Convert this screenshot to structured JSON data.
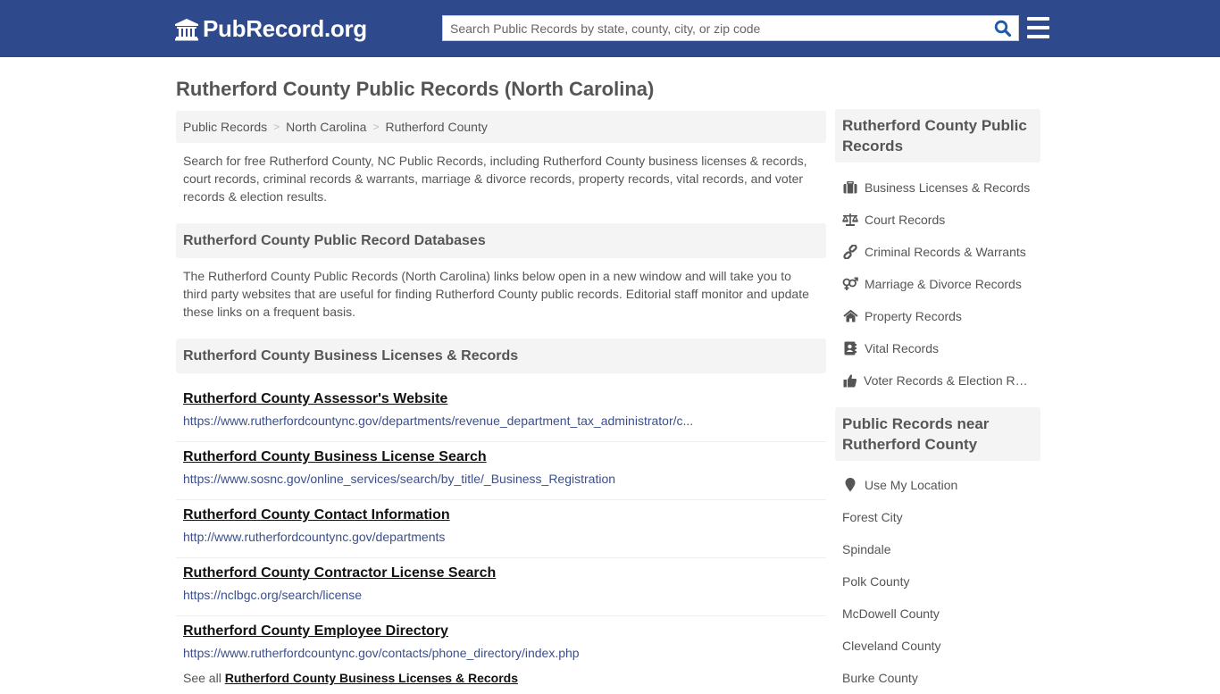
{
  "header": {
    "logo_text": "PubRecord.org",
    "search_placeholder": "Search Public Records by state, county, city, or zip code",
    "search_value": "",
    "brand_color": "#2e4a8c"
  },
  "page_title": "Rutherford County Public Records (North Carolina)",
  "breadcrumb": [
    {
      "label": "Public Records"
    },
    {
      "label": "North Carolina"
    },
    {
      "label": "Rutherford County"
    }
  ],
  "intro": "Search for free Rutherford County, NC Public Records, including Rutherford County business licenses & records, court records, criminal records & warrants, marriage & divorce records, property records, vital records, and voter records & election results.",
  "databases": {
    "heading": "Rutherford County Public Record Databases",
    "text": "The Rutherford County Public Records (North Carolina) links below open in a new window and will take you to third party websites that are useful for finding Rutherford County public records. Editorial staff monitor and update these links on a frequent basis."
  },
  "business": {
    "heading": "Rutherford County Business Licenses & Records",
    "links": [
      {
        "title": "Rutherford County Assessor's Website",
        "url": "https://www.rutherfordcountync.gov/departments/revenue_department_tax_administrator/c..."
      },
      {
        "title": "Rutherford County Business License Search",
        "url": "https://www.sosnc.gov/online_services/search/by_title/_Business_Registration"
      },
      {
        "title": "Rutherford County Contact Information",
        "url": "http://www.rutherfordcountync.gov/departments"
      },
      {
        "title": "Rutherford County Contractor License Search",
        "url": "https://nclbgc.org/search/license"
      },
      {
        "title": "Rutherford County Employee Directory",
        "url": "https://www.rutherfordcountync.gov/contacts/phone_directory/index.php"
      }
    ],
    "see_all_prefix": "See all",
    "see_all_link": "Rutherford County Business Licenses & Records"
  },
  "sidebar": {
    "records_heading": "Rutherford County Public Records",
    "records": [
      {
        "label": "Business Licenses & Records",
        "icon": "briefcase-icon"
      },
      {
        "label": "Court Records",
        "icon": "balance-scale-icon"
      },
      {
        "label": "Criminal Records & Warrants",
        "icon": "link-icon"
      },
      {
        "label": "Marriage & Divorce Records",
        "icon": "venus-mars-icon"
      },
      {
        "label": "Property Records",
        "icon": "home-icon"
      },
      {
        "label": "Vital Records",
        "icon": "address-book-icon"
      },
      {
        "label": "Voter Records & Election Results",
        "icon": "thumbs-up-icon"
      }
    ],
    "near_heading": "Public Records near Rutherford County",
    "use_location": "Use My Location",
    "near": [
      {
        "label": "Forest City"
      },
      {
        "label": "Spindale"
      },
      {
        "label": "Polk County"
      },
      {
        "label": "McDowell County"
      },
      {
        "label": "Cleveland County"
      },
      {
        "label": "Burke County"
      }
    ]
  }
}
